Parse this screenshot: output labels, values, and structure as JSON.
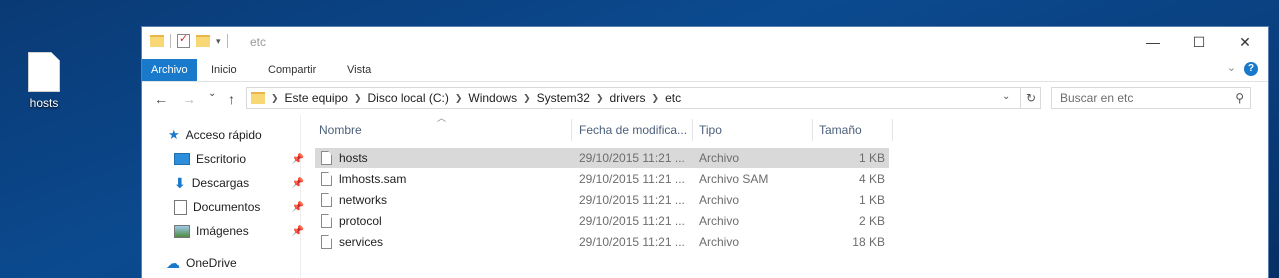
{
  "desktop": {
    "icon_label": "hosts"
  },
  "window": {
    "title": "etc",
    "controls": {
      "minimize": "—",
      "maximize": "☐",
      "close": "✕"
    }
  },
  "ribbon": {
    "tabs": [
      "Archivo",
      "Inicio",
      "Compartir",
      "Vista"
    ],
    "help": "?"
  },
  "nav": {
    "back": "←",
    "forward": "→",
    "recent": "⌄",
    "up": "↑",
    "breadcrumbs": [
      "Este equipo",
      "Disco local (C:)",
      "Windows",
      "System32",
      "drivers",
      "etc"
    ],
    "search_placeholder": "Buscar en etc"
  },
  "sidebar": {
    "items": [
      {
        "label": "Acceso rápido",
        "icon": "star-icon",
        "pinned": false
      },
      {
        "label": "Escritorio",
        "icon": "desktop-folder-icon",
        "pinned": true
      },
      {
        "label": "Descargas",
        "icon": "download-icon",
        "pinned": true
      },
      {
        "label": "Documentos",
        "icon": "documents-icon",
        "pinned": true
      },
      {
        "label": "Imágenes",
        "icon": "pictures-icon",
        "pinned": true
      },
      {
        "label": "OneDrive",
        "icon": "cloud-icon",
        "pinned": false
      }
    ]
  },
  "list": {
    "columns": [
      "Nombre",
      "Fecha de modifica...",
      "Tipo",
      "Tamaño"
    ],
    "rows": [
      {
        "name": "hosts",
        "date": "29/10/2015 11:21 ...",
        "type": "Archivo",
        "size": "1 KB",
        "selected": true
      },
      {
        "name": "lmhosts.sam",
        "date": "29/10/2015 11:21 ...",
        "type": "Archivo SAM",
        "size": "4 KB",
        "selected": false
      },
      {
        "name": "networks",
        "date": "29/10/2015 11:21 ...",
        "type": "Archivo",
        "size": "1 KB",
        "selected": false
      },
      {
        "name": "protocol",
        "date": "29/10/2015 11:21 ...",
        "type": "Archivo",
        "size": "2 KB",
        "selected": false
      },
      {
        "name": "services",
        "date": "29/10/2015 11:21 ...",
        "type": "Archivo",
        "size": "18 KB",
        "selected": false
      }
    ]
  },
  "colors": {
    "accent": "#1979ca",
    "selection": "#d9d9d9"
  }
}
